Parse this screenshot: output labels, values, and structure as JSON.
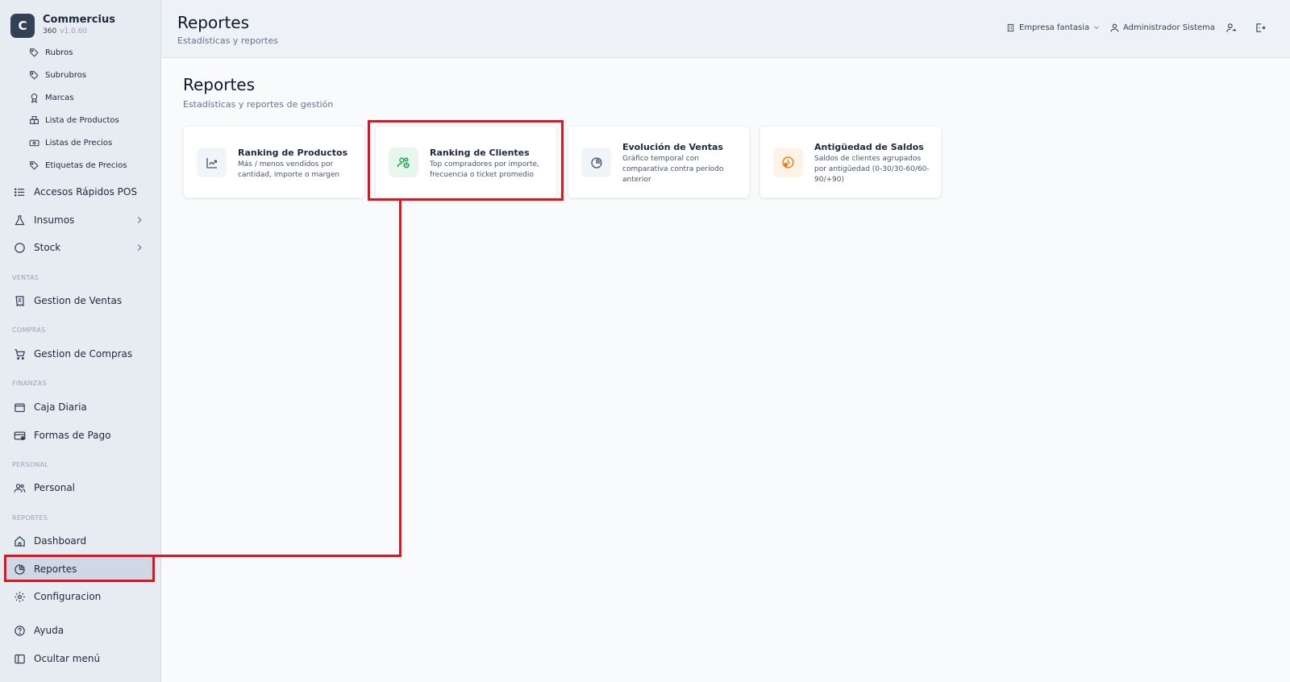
{
  "brand": {
    "logo_letter": "C",
    "name": "Commercius",
    "sub": "360",
    "version": "v1.0.60"
  },
  "sidebar": {
    "sub_items": [
      {
        "label": "Rubros",
        "icon": "tag-icon"
      },
      {
        "label": "Subrubros",
        "icon": "tag-icon"
      },
      {
        "label": "Marcas",
        "icon": "award-icon"
      },
      {
        "label": "Lista de Productos",
        "icon": "boxes-icon"
      },
      {
        "label": "Listas de Precios",
        "icon": "banknote-icon"
      },
      {
        "label": "Etiquetas de Precios",
        "icon": "tag-icon"
      }
    ],
    "items": {
      "accesos": "Accesos Rápidos POS",
      "insumos": "Insumos",
      "stock": "Stock",
      "gestion_ventas": "Gestion de Ventas",
      "gestion_compras": "Gestion de Compras",
      "caja_diaria": "Caja Diaria",
      "formas_pago": "Formas de Pago",
      "personal": "Personal",
      "dashboard": "Dashboard",
      "reportes": "Reportes",
      "configuracion": "Configuracion",
      "ayuda": "Ayuda",
      "ocultar": "Ocultar menú"
    },
    "sections": {
      "ventas": "VENTAS",
      "compras": "COMPRAS",
      "finanzas": "FINANZAS",
      "personal": "PERSONAL",
      "reportes": "REPORTES"
    }
  },
  "header": {
    "title": "Reportes",
    "subtitle": "Estadísticas y reportes",
    "company": "Empresa fantasia",
    "user": "Administrador Sistema"
  },
  "main": {
    "title": "Reportes",
    "subtitle": "Estadísticas y reportes de gestión",
    "cards": [
      {
        "title": "Ranking de Productos",
        "desc": "Más / menos vendidos por cantidad, importe o margen",
        "icon": "trending-up-icon"
      },
      {
        "title": "Ranking de Clientes",
        "desc": "Top compradores por importe, frecuencia o ticket promedio",
        "icon": "users-icon"
      },
      {
        "title": "Evolución de Ventas",
        "desc": "Gráfico temporal con comparativa contra período anterior",
        "icon": "chart-pie-icon"
      },
      {
        "title": "Antigüedad de Saldos",
        "desc": "Saldos de clientes agrupados por antigüedad (0-30/30-60/60-90/+90)",
        "icon": "clock-alert-icon"
      }
    ]
  },
  "colors": {
    "highlight": "#e0141e",
    "sidebar_bg": "#e7ecf3",
    "accent_green": "#16a34a",
    "accent_orange": "#ea7a1a"
  }
}
